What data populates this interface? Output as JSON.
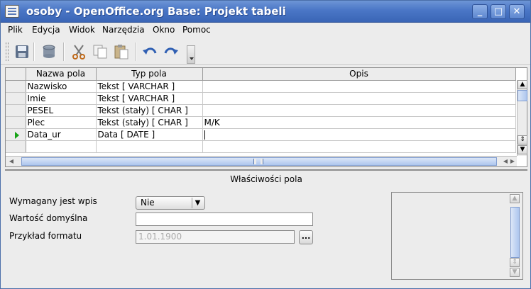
{
  "window": {
    "title": "osoby - OpenOffice.org Base: Projekt tabeli",
    "controls": [
      "_",
      "□",
      "✕"
    ]
  },
  "menu": {
    "items": [
      "Plik",
      "Edycja",
      "Widok",
      "Narzędzia",
      "Okno",
      "Pomoc"
    ]
  },
  "toolbar": {
    "buttons": [
      "save-icon",
      "database-icon",
      "cut-icon",
      "copy-icon",
      "paste-icon",
      "undo-icon",
      "redo-icon"
    ]
  },
  "table": {
    "headers": [
      "Nazwa pola",
      "Typ pola",
      "Opis"
    ],
    "rows": [
      {
        "name": "Nazwisko",
        "type": "Tekst [ VARCHAR ]",
        "desc": ""
      },
      {
        "name": "Imie",
        "type": "Tekst [ VARCHAR ]",
        "desc": ""
      },
      {
        "name": "PESEL",
        "type": "Tekst (stały) [ CHAR ]",
        "desc": ""
      },
      {
        "name": "Plec",
        "type": "Tekst (stały) [ CHAR ]",
        "desc": "M/K"
      },
      {
        "name": "Data_ur",
        "type": "Data [ DATE ]",
        "desc": ""
      }
    ],
    "current_row": 4
  },
  "properties": {
    "title": "Właściwości pola",
    "required_label": "Wymagany jest wpis",
    "required_value": "Nie",
    "default_label": "Wartość domyślna",
    "default_value": "",
    "format_label": "Przykład formatu",
    "format_value": "1.01.1900",
    "format_button": "..."
  }
}
